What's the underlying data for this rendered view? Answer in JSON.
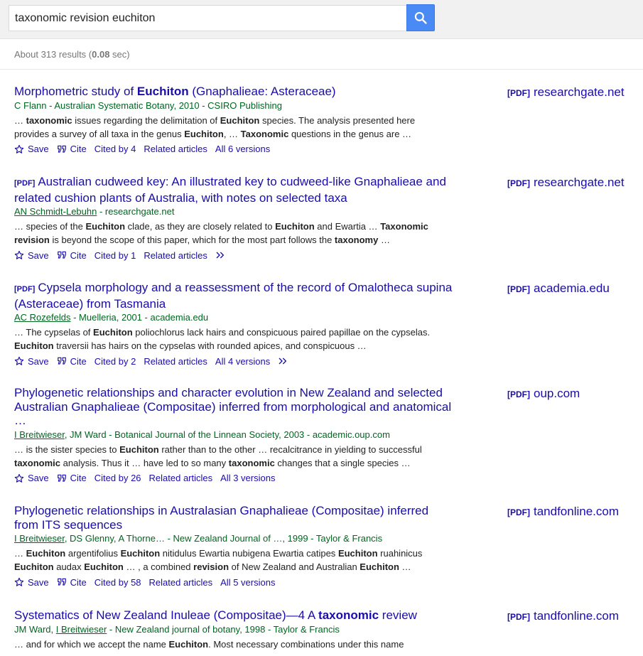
{
  "search": {
    "query": "taxonomic revision euchiton",
    "button_icon": "search-icon"
  },
  "stats": {
    "prefix": "About 313 results (",
    "time": "0.08",
    "suffix": " sec)"
  },
  "actions": {
    "save": "Save",
    "cite": "Cite",
    "related": "Related articles"
  },
  "results": [
    {
      "tag": "",
      "title_parts": [
        [
          "Morphometric study of ",
          false
        ],
        [
          "Euchiton",
          true
        ],
        [
          " (Gnaphalieae: Asteraceae)",
          false
        ]
      ],
      "authors_parts": [
        [
          "C Flann - Australian Systematic Botany, 2010 - CSIRO Publishing",
          false
        ]
      ],
      "snippet_parts": [
        [
          "… ",
          false
        ],
        [
          "taxonomic",
          true
        ],
        [
          " issues regarding the delimitation of ",
          false
        ],
        [
          "Euchiton",
          true
        ],
        [
          " species. The analysis presented here provides a survey of all taxa in the genus ",
          false
        ],
        [
          "Euchiton",
          true
        ],
        [
          ", … ",
          false
        ],
        [
          "Taxonomic",
          true
        ],
        [
          " questions in the genus are …",
          false
        ]
      ],
      "cited_by": "Cited by 4",
      "versions": "All 6 versions",
      "more": false,
      "side_tag": "[PDF]",
      "side_source": "researchgate.net"
    },
    {
      "tag": "[PDF]",
      "title_parts": [
        [
          "Australian cudweed key: An illustrated key to cudweed-like Gnaphalieae and related cushion plants of Australia, with notes on selected taxa",
          false
        ]
      ],
      "authors_parts": [
        [
          "AN Schmidt-Lebuhn",
          "u"
        ],
        [
          " - researchgate.net",
          false
        ]
      ],
      "snippet_parts": [
        [
          "… species of the ",
          false
        ],
        [
          "Euchiton",
          true
        ],
        [
          " clade, as they are closely related to ",
          false
        ],
        [
          "Euchiton",
          true
        ],
        [
          " and Ewartia … ",
          false
        ],
        [
          "Taxonomic revision",
          true
        ],
        [
          " is beyond the scope of this paper, which for the most part follows the ",
          false
        ],
        [
          "taxonomy",
          true
        ],
        [
          " …",
          false
        ]
      ],
      "cited_by": "Cited by 1",
      "versions": "",
      "more": true,
      "side_tag": "[PDF]",
      "side_source": "researchgate.net"
    },
    {
      "tag": "[PDF]",
      "title_parts": [
        [
          "Cypsela morphology and a reassessment of the record of Omalotheca supina (Asteraceae) from Tasmania",
          false
        ]
      ],
      "authors_parts": [
        [
          "AC Rozefelds",
          "u"
        ],
        [
          " - Muelleria, 2001 - academia.edu",
          false
        ]
      ],
      "snippet_parts": [
        [
          "… The cypselas of ",
          false
        ],
        [
          "Euchiton",
          true
        ],
        [
          " poliochlorus lack hairs and conspicuous paired papillae on the cypselas. ",
          false
        ],
        [
          "Euchiton",
          true
        ],
        [
          " traversii has hairs on the cypselas with rounded apices, and conspicuous …",
          false
        ]
      ],
      "cited_by": "Cited by 2",
      "versions": "All 4 versions",
      "more": true,
      "side_tag": "[PDF]",
      "side_source": "academia.edu"
    },
    {
      "tag": "",
      "title_parts": [
        [
          "Phylogenetic relationships and character evolution in New Zealand and selected Australian Gnaphalieae (Compositae) inferred from morphological and anatomical …",
          false
        ]
      ],
      "authors_parts": [
        [
          "I Breitwieser",
          "u"
        ],
        [
          ", JM Ward - Botanical Journal of the Linnean Society, 2003 - academic.oup.com",
          false
        ]
      ],
      "snippet_parts": [
        [
          "… is the sister species to ",
          false
        ],
        [
          "Euchiton",
          true
        ],
        [
          " rather than to the other … recalcitrance in yielding to successful ",
          false
        ],
        [
          "taxonomic",
          true
        ],
        [
          " analysis. Thus it … have led to so many ",
          false
        ],
        [
          "taxonomic",
          true
        ],
        [
          " changes that a single species …",
          false
        ]
      ],
      "cited_by": "Cited by 26",
      "versions": "All 3 versions",
      "more": false,
      "side_tag": "[PDF]",
      "side_source": "oup.com"
    },
    {
      "tag": "",
      "title_parts": [
        [
          "Phylogenetic relationships in Australasian Gnaphalieae (Compositae) inferred from ITS sequences",
          false
        ]
      ],
      "authors_parts": [
        [
          "I Breitwieser",
          "u"
        ],
        [
          ", DS Glenny, A Thorne… - New Zealand Journal of …, 1999 - Taylor & Francis",
          false
        ]
      ],
      "snippet_parts": [
        [
          "… ",
          false
        ],
        [
          "Euchiton",
          true
        ],
        [
          " argentifolius ",
          false
        ],
        [
          "Euchiton",
          true
        ],
        [
          " nitidulus Ewartia nubigena Ewartia catipes ",
          false
        ],
        [
          "Euchiton",
          true
        ],
        [
          " ruahinicus ",
          false
        ],
        [
          "Euchiton",
          true
        ],
        [
          " audax ",
          false
        ],
        [
          "Euchiton",
          true
        ],
        [
          " … , a combined ",
          false
        ],
        [
          "revision",
          true
        ],
        [
          " of New Zealand and Australian ",
          false
        ],
        [
          "Euchiton",
          true
        ],
        [
          " …",
          false
        ]
      ],
      "cited_by": "Cited by 58",
      "versions": "All 5 versions",
      "more": false,
      "side_tag": "[PDF]",
      "side_source": "tandfonline.com"
    },
    {
      "tag": "",
      "title_parts": [
        [
          "Systematics of New Zealand Inuleae (Compositae)—4 A ",
          false
        ],
        [
          "taxonomic",
          true
        ],
        [
          " review",
          false
        ]
      ],
      "authors_parts": [
        [
          "JM Ward, ",
          false
        ],
        [
          "I Breitwieser",
          "u"
        ],
        [
          " - New Zealand journal of botany, 1998 - Taylor & Francis",
          false
        ]
      ],
      "snippet_parts": [
        [
          "… and for which we accept the name ",
          false
        ],
        [
          "Euchiton",
          true
        ],
        [
          ". Most necessary combinations under this name",
          false
        ]
      ],
      "cited_by": "",
      "versions": "",
      "more": false,
      "side_tag": "[PDF]",
      "side_source": "tandfonline.com"
    }
  ]
}
